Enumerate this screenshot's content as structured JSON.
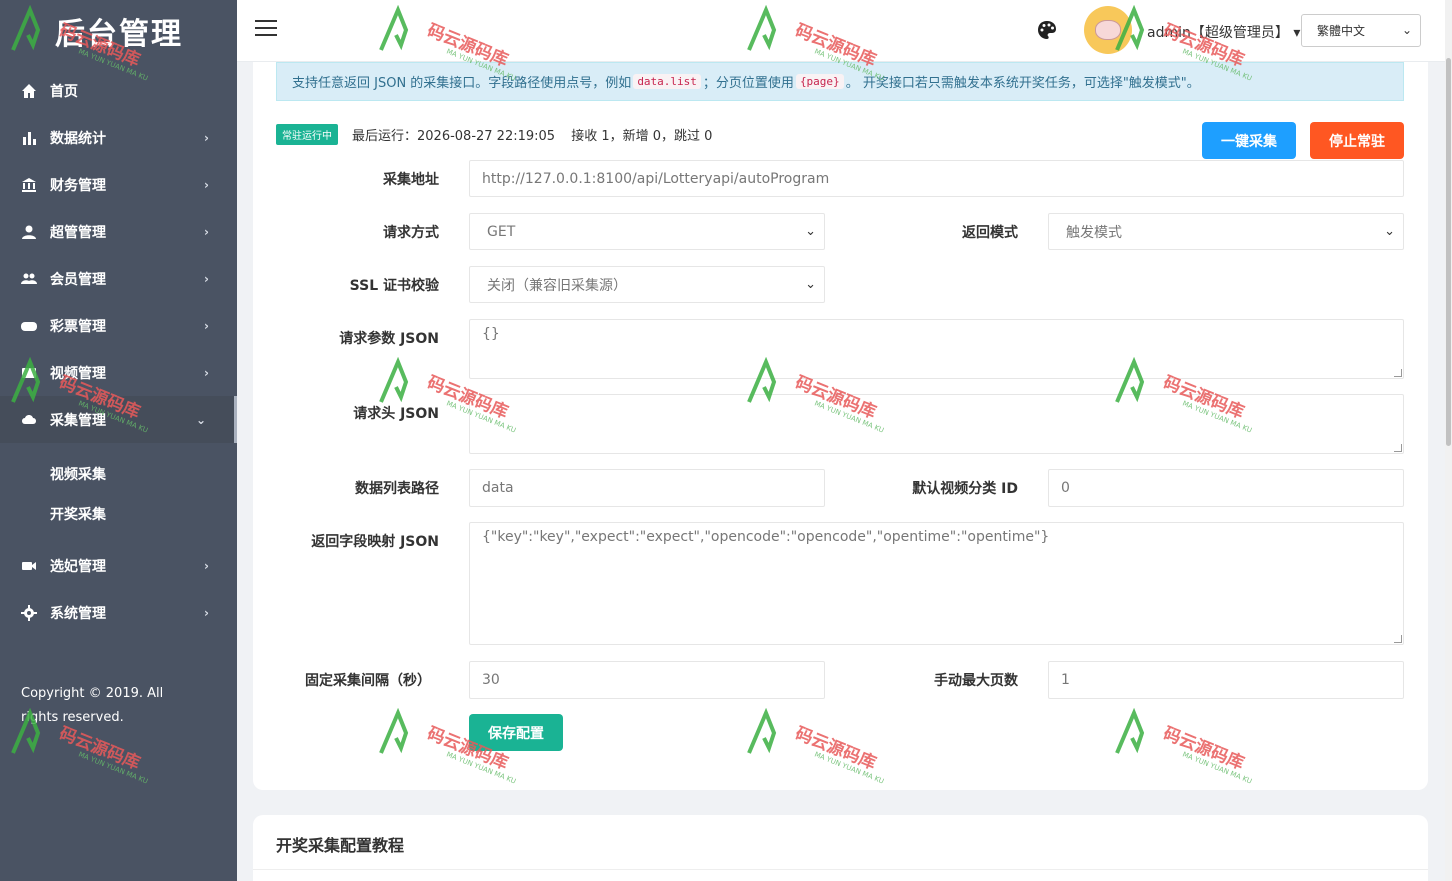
{
  "sidebar": {
    "brand": "后台管理",
    "items": [
      {
        "label": "首页",
        "icon": "home-icon",
        "arrow": ""
      },
      {
        "label": "数据统计",
        "icon": "bar-chart-icon",
        "arrow": "›"
      },
      {
        "label": "财务管理",
        "icon": "bank-icon",
        "arrow": "›"
      },
      {
        "label": "超管管理",
        "icon": "user-icon",
        "arrow": "›"
      },
      {
        "label": "会员管理",
        "icon": "users-icon",
        "arrow": "›"
      },
      {
        "label": "彩票管理",
        "icon": "gamepad-icon",
        "arrow": "›"
      },
      {
        "label": "视频管理",
        "icon": "video-icon",
        "arrow": "›"
      },
      {
        "label": "采集管理",
        "icon": "cloud-download-icon",
        "arrow": "⌄"
      }
    ],
    "submenu": [
      "视频采集",
      "开奖采集"
    ],
    "items_after": [
      {
        "label": "选妃管理",
        "icon": "camera-icon",
        "arrow": "›"
      },
      {
        "label": "系统管理",
        "icon": "gear-icon",
        "arrow": "›"
      }
    ],
    "copyright": "Copyright © 2019. All rights reserved."
  },
  "topbar": {
    "user": "admin【超级管理员】",
    "user_caret": "▾",
    "language": "繁體中文"
  },
  "alert": {
    "text1": "支持任意返回 JSON 的采集接口。字段路径使用点号，例如",
    "code1": "data.list",
    "text2": "；分页位置使用",
    "code2": "{page}",
    "text3": "。 开奖接口若只需触发本系统开奖任务，可选择\"触发模式\"。"
  },
  "status": {
    "badge": "常驻运行中",
    "last_run": "最后运行：2026-08-27 22:19:05",
    "counts": "接收 1，新增 0，跳过 0"
  },
  "buttons": {
    "collect": "一键采集",
    "stop": "停止常驻",
    "save": "保存配置"
  },
  "form": {
    "url_label": "采集地址",
    "url_value": "http://127.0.0.1:8100/api/Lotteryapi/autoProgram",
    "method_label": "请求方式",
    "method_value": "GET",
    "return_mode_label": "返回模式",
    "return_mode_value": "触发模式",
    "ssl_label": "SSL 证书校验",
    "ssl_value": "关闭（兼容旧采集源）",
    "params_label": "请求参数 JSON",
    "params_value": "{}",
    "headers_label": "请求头 JSON",
    "headers_value": "",
    "list_path_label": "数据列表路径",
    "list_path_placeholder": "data",
    "category_label": "默认视频分类 ID",
    "category_value": "0",
    "mapping_label": "返回字段映射 JSON",
    "mapping_value": "{\"key\":\"key\",\"expect\":\"expect\",\"opencode\":\"opencode\",\"opentime\":\"opentime\"}",
    "interval_label": "固定采集间隔（秒）",
    "interval_value": "30",
    "max_pages_label": "手动最大页数",
    "max_pages_value": "1"
  },
  "tutorial": {
    "title": "开奖采集配置教程"
  },
  "watermark": {
    "text": "码云源码库",
    "sub": "MA YUN YUAN MA KU"
  },
  "colors": {
    "sidebar_bg": "#4a5363",
    "primary_blue": "#1e9fff",
    "danger_orange": "#ff5722",
    "success_teal": "#1ab394",
    "alert_bg": "#d9edf7"
  }
}
